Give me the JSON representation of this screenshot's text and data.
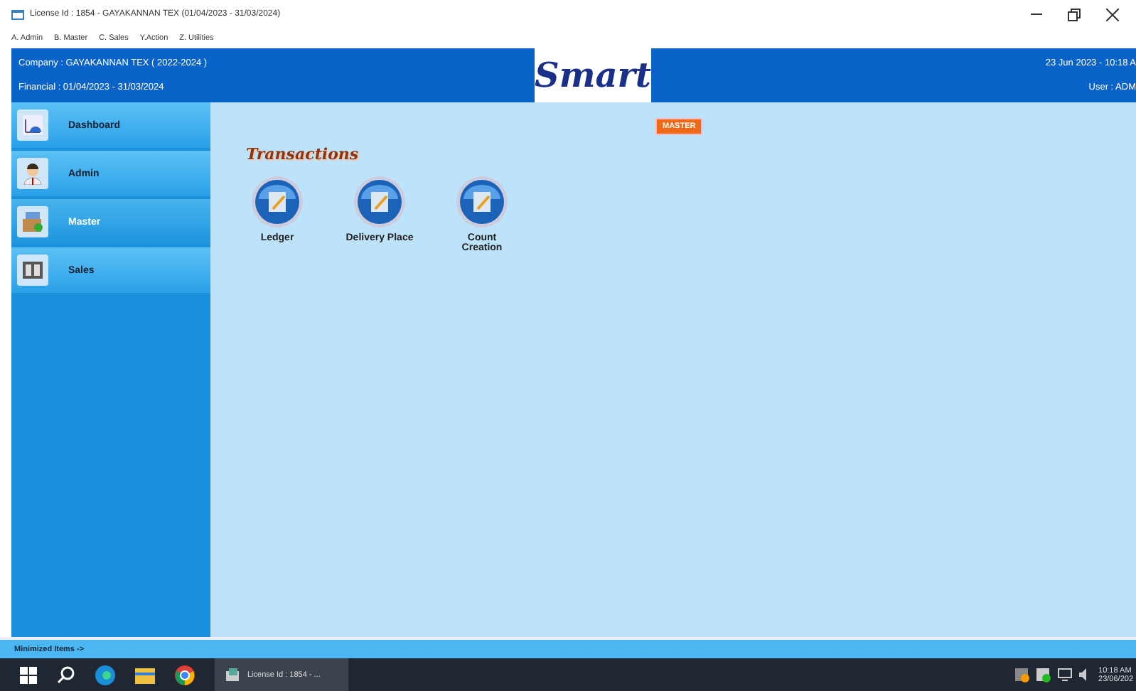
{
  "window": {
    "title": "License Id : 1854 - GAYAKANNAN TEX (01/04/2023 - 31/03/2024)"
  },
  "menu": [
    "A. Admin",
    "B. Master",
    "C. Sales",
    "Y.Action",
    "Z. Utilities"
  ],
  "header": {
    "company": "Company : GAYAKANNAN TEX ( 2022-2024 )",
    "financial": "Financial : 01/04/2023 - 31/03/2024",
    "logo": "Smart",
    "datetime": "23 Jun 2023 - 10:18 A",
    "user": "User : ADM"
  },
  "sidebar": {
    "items": [
      {
        "label": "Dashboard",
        "kind": "dashboard",
        "selected": false
      },
      {
        "label": "Admin",
        "kind": "admin",
        "selected": false
      },
      {
        "label": "Master",
        "kind": "master",
        "selected": true
      },
      {
        "label": "Sales",
        "kind": "sales",
        "selected": false
      }
    ]
  },
  "content": {
    "badge": "MASTER",
    "section": "Transactions",
    "tiles": [
      "Ledger",
      "Delivery Place",
      "Count Creation"
    ]
  },
  "status_bar": "Minimized Items ->",
  "taskbar": {
    "app": "License Id : 1854 - ...",
    "time": "10:18 AM",
    "date": "23/06/202"
  }
}
